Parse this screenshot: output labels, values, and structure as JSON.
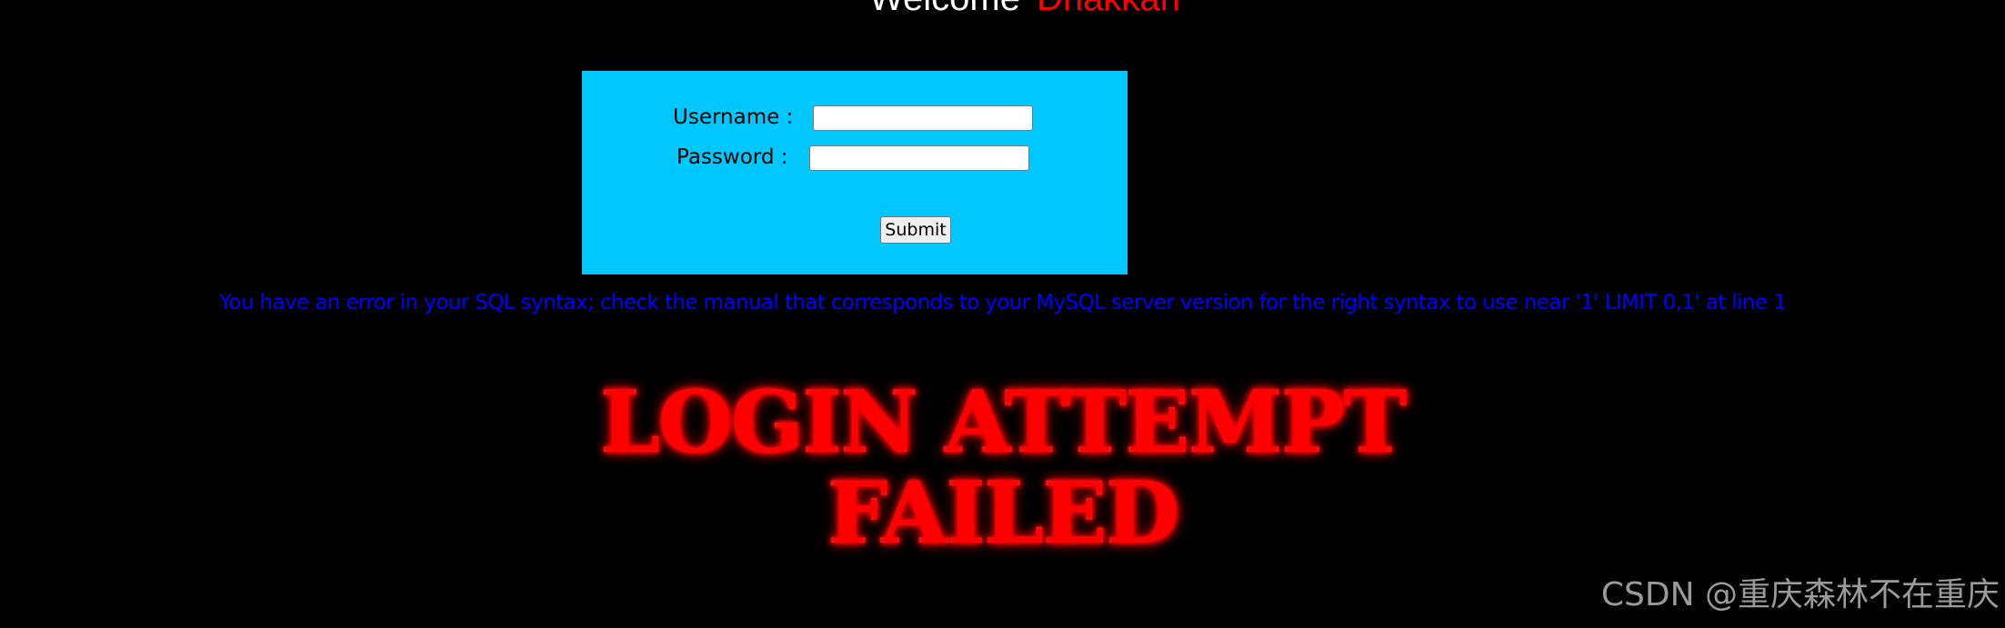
{
  "header": {
    "welcome_text": "Welcome",
    "user_name": "Dhakkan"
  },
  "login_form": {
    "username_label": "Username :",
    "username_value": "",
    "password_label": "Password :",
    "password_value": "",
    "submit_label": "Submit"
  },
  "error": {
    "message": "You have an error in your SQL syntax; check the manual that corresponds to your MySQL server version for the right syntax to use near '1' LIMIT 0,1' at line 1"
  },
  "banner": {
    "line1": "LOGIN ATTEMPT",
    "line2": "FAILED"
  },
  "watermark": {
    "text": "CSDN @重庆森林不在重庆"
  },
  "colors": {
    "background": "#000000",
    "form_background": "#00c8ff",
    "error_text": "#0000ff",
    "name_accent": "#ff0000"
  }
}
